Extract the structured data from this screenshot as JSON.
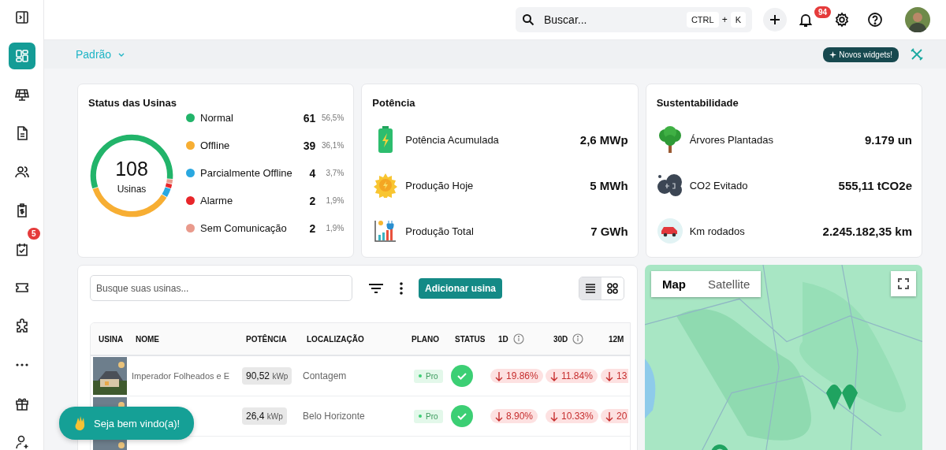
{
  "sidebar": {
    "items": [
      {
        "selected": true
      },
      {
        "selected": false
      },
      {
        "selected": false
      },
      {
        "selected": false
      },
      {
        "selected": false
      },
      {
        "selected": false,
        "badge": "5"
      },
      {
        "selected": false
      },
      {
        "selected": false
      },
      {
        "selected": false
      },
      {
        "selected": false
      },
      {
        "selected": false
      }
    ]
  },
  "topbar": {
    "search": {
      "placeholder": "Buscar...",
      "shortcut": [
        "CTRL",
        "+",
        "K"
      ]
    },
    "notifications": "94"
  },
  "subheader": {
    "view": "Padrão",
    "new_widgets": "Novos widgets!"
  },
  "status_card": {
    "title": "Status das Usinas",
    "total": "108",
    "total_label": "Usinas",
    "statuses": [
      {
        "label": "Normal",
        "count": "61",
        "percent": "56,5%",
        "color": "#22b46a"
      },
      {
        "label": "Offline",
        "count": "39",
        "percent": "36,1%",
        "color": "#f7ae33"
      },
      {
        "label": "Parcialmente Offline",
        "count": "4",
        "percent": "3,7%",
        "color": "#2aa8e0"
      },
      {
        "label": "Alarme",
        "count": "2",
        "percent": "1,9%",
        "color": "#e8262a"
      },
      {
        "label": "Sem Comunicação",
        "count": "2",
        "percent": "1,9%",
        "color": "#e99a8c"
      }
    ]
  },
  "power_card": {
    "title": "Potência",
    "metrics": [
      {
        "label": "Potência Acumulada",
        "value": "2,6 MWp"
      },
      {
        "label": "Produção Hoje",
        "value": "5 MWh"
      },
      {
        "label": "Produção Total",
        "value": "7 GWh"
      }
    ]
  },
  "sustainability_card": {
    "title": "Sustentabilidade",
    "metrics": [
      {
        "label": "Árvores Plantadas",
        "value": "9.179 un"
      },
      {
        "label": "CO2 Evitado",
        "value": "555,11 tCO2e"
      },
      {
        "label": "Km rodados",
        "value": "2.245.182,35 km"
      }
    ]
  },
  "plants": {
    "search": {
      "placeholder": "Busque suas usinas..."
    },
    "add_button": "Adicionar usina",
    "views": [
      {
        "selected": true
      },
      {
        "selected": false
      }
    ],
    "columns": [
      {
        "label": "USINA"
      },
      {
        "label": "NOME"
      },
      {
        "label": "POTÊNCIA"
      },
      {
        "label": "LOCALIZAÇÃO"
      },
      {
        "label": "PLANO"
      },
      {
        "label": "STATUS"
      },
      {
        "label": "1D",
        "info": true
      },
      {
        "label": "30D",
        "info": true
      },
      {
        "label": "12M"
      }
    ],
    "rows": [
      {
        "kind": "full",
        "name": "Imperador Folheados e E",
        "power": "90,52",
        "unit": "kWp",
        "location": "Contagem",
        "plan": "Pro",
        "changes": [
          {
            "value": "19.86%"
          },
          {
            "value": "11.84%"
          },
          {
            "value": "13"
          }
        ]
      },
      {
        "kind": "full",
        "power": "26,4",
        "unit": "kWp",
        "location": "Belo Horizonte",
        "plan": "Pro",
        "changes": [
          {
            "value": "8.90%"
          },
          {
            "value": "10.33%"
          },
          {
            "value": "20"
          }
        ]
      },
      {
        "kind": "cut"
      }
    ]
  },
  "map": {
    "modes": [
      {
        "label": "Map",
        "selected": true
      },
      {
        "label": "Satellite",
        "selected": false
      }
    ]
  },
  "welcome": "Seja bem vindo(a)!"
}
